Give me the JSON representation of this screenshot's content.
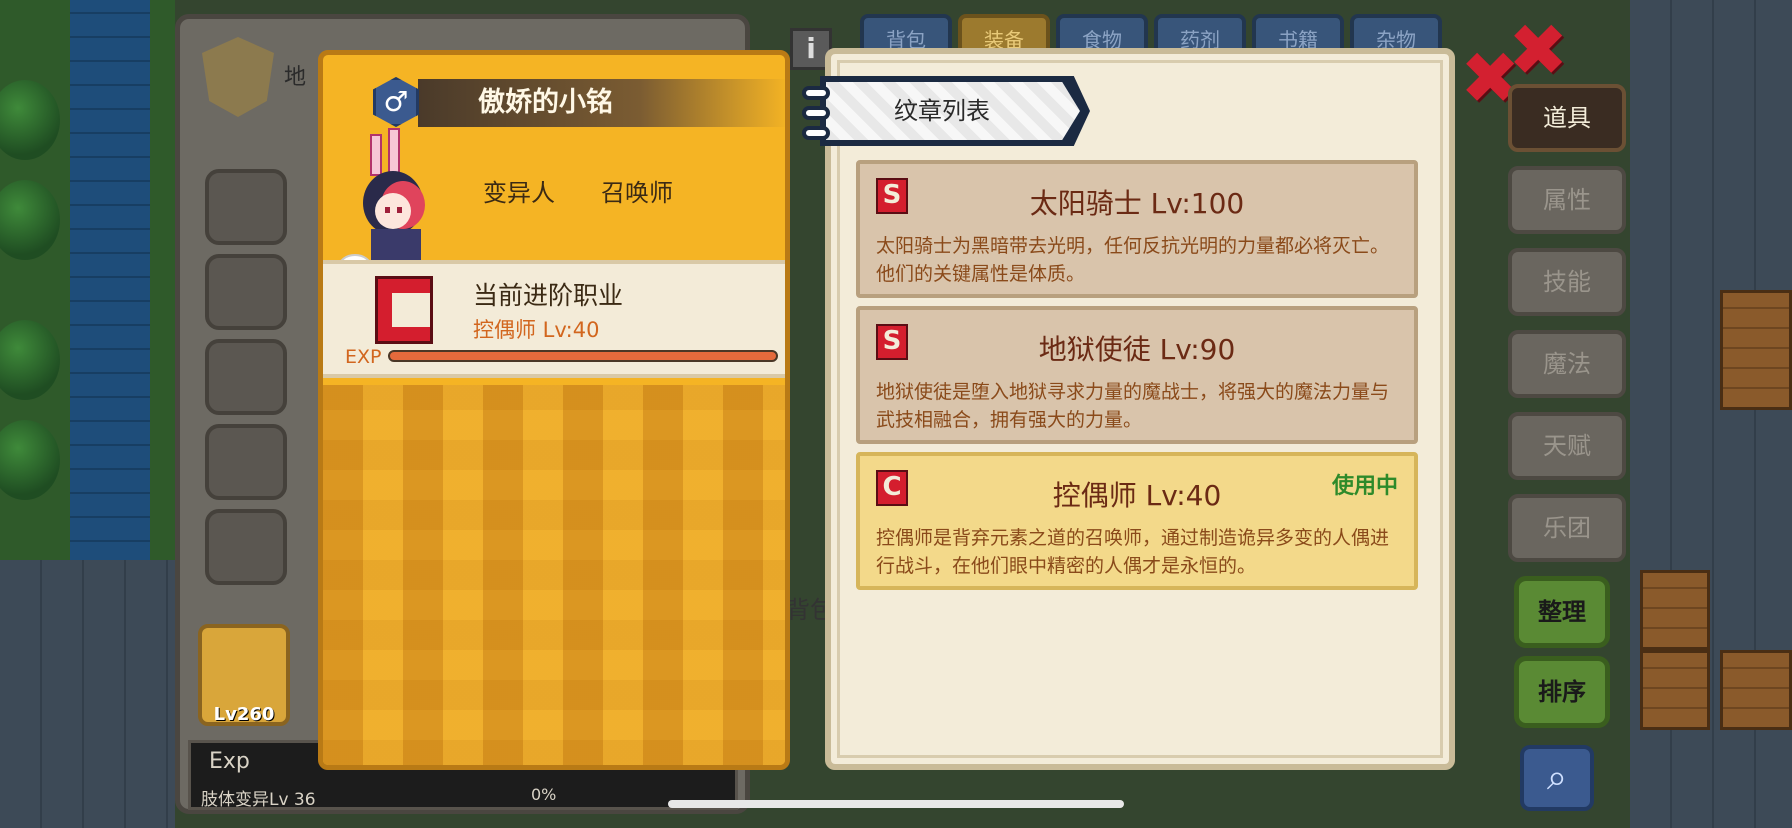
{
  "character": {
    "name": "傲娇的小铭",
    "gender_symbol": "♂",
    "race": "变异人",
    "class": "召唤师",
    "advance_title": "当前进阶职业",
    "advance_class": "控偶师 Lv:40",
    "exp_tag": "EXP",
    "level_badge": "Lv260"
  },
  "left_panel": {
    "title_fragment": "地",
    "exp_label": "Exp",
    "mutation": "肢体变异Lv 36",
    "mutation_pct": "0%"
  },
  "top_tabs": [
    "背包",
    "装备",
    "食物",
    "药剂",
    "书籍",
    "杂物"
  ],
  "bag_label": "背包",
  "emblem_list": {
    "header": "纹章列表",
    "items": [
      {
        "rank": "S",
        "name": "太阳骑士 Lv:100",
        "desc": "太阳骑士为黑暗带去光明，任何反抗光明的力量都必将灭亡。他们的关键属性是体质。",
        "status": ""
      },
      {
        "rank": "S",
        "name": "地狱使徒 Lv:90",
        "desc": "地狱使徒是堕入地狱寻求力量的魔战士，将强大的魔法力量与武技相融合，拥有强大的力量。",
        "status": ""
      },
      {
        "rank": "C",
        "name": "控偶师 Lv:40",
        "desc": "控偶师是背弃元素之道的召唤师，通过制造诡异多变的人偶进行战斗，在他们眼中精密的人偶才是永恒的。",
        "status": "使用中"
      }
    ]
  },
  "side_menu": {
    "items": [
      "道具",
      "属性",
      "技能",
      "魔法",
      "天赋",
      "乐团"
    ],
    "active": "道具"
  },
  "action_buttons": {
    "organize": "整理",
    "sort": "排序"
  },
  "icons": {
    "close": "close-icon",
    "search": "search-icon",
    "info": "info-icon"
  },
  "colors": {
    "card_bg": "#f5b424",
    "rank_red": "#d41e2e",
    "in_use_green": "#2e8a2a"
  }
}
